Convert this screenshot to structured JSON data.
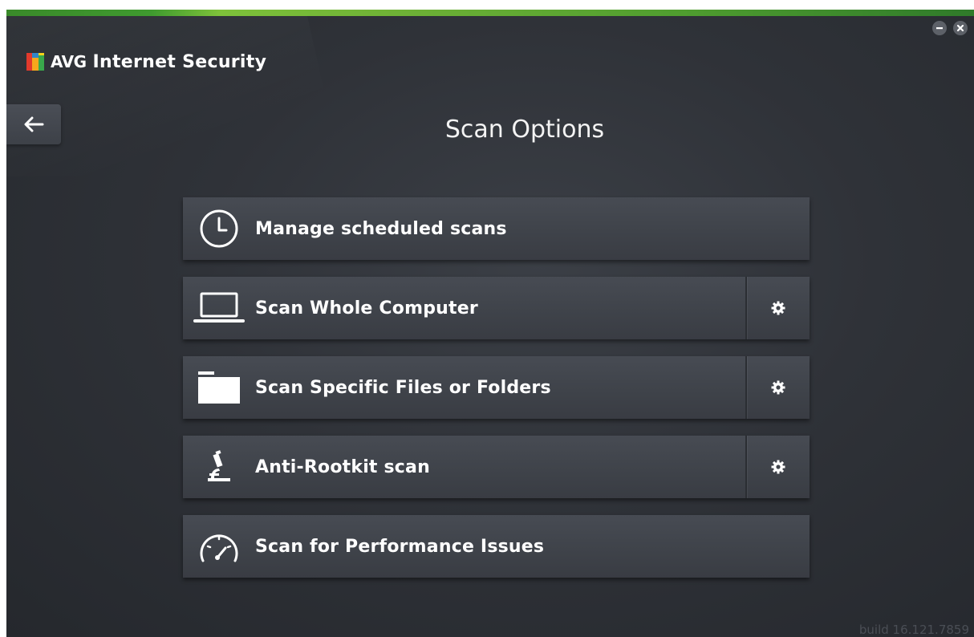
{
  "app": {
    "brand": "AVG",
    "product": "Internet Security"
  },
  "window_controls": {
    "minimize_icon": "minus-icon",
    "close_icon": "close-icon"
  },
  "nav": {
    "back_icon": "arrow-left-icon"
  },
  "page": {
    "title": "Scan Options"
  },
  "menu": {
    "items": [
      {
        "label": "Manage scheduled scans",
        "icon": "clock-icon",
        "has_settings": false
      },
      {
        "label": "Scan Whole Computer",
        "icon": "laptop-icon",
        "has_settings": true
      },
      {
        "label": "Scan Specific Files or Folders",
        "icon": "folder-icon",
        "has_settings": true
      },
      {
        "label": "Anti-Rootkit scan",
        "icon": "microscope-icon",
        "has_settings": true
      },
      {
        "label": "Scan for Performance Issues",
        "icon": "speedometer-icon",
        "has_settings": false
      }
    ],
    "settings_icon": "gear-icon"
  },
  "footer": {
    "build": "build 16.121.7859"
  },
  "colors": {
    "accent_green": "#7ec13a",
    "background": "#2f3238",
    "tile": "#42464d",
    "text": "#ffffff"
  }
}
